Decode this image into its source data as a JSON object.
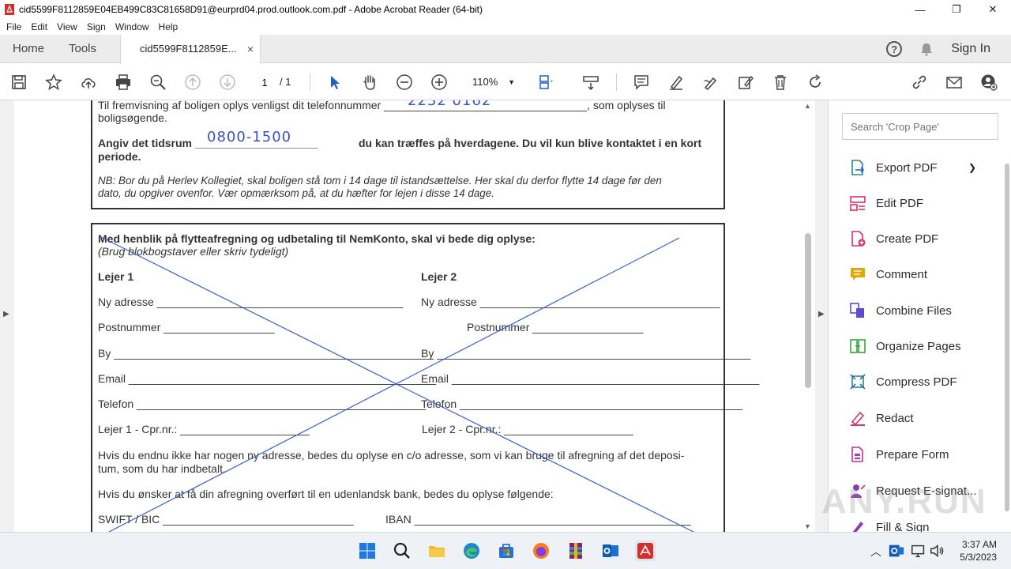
{
  "window": {
    "title": "cid5599F8112859E04EB499C83C81658D91@eurprd04.prod.outlook.com.pdf - Adobe Acrobat Reader (64-bit)",
    "minimize": "—",
    "maximize": "❐",
    "close": "✕"
  },
  "menu": [
    "File",
    "Edit",
    "View",
    "Sign",
    "Window",
    "Help"
  ],
  "tabs": {
    "home": "Home",
    "tools": "Tools",
    "doc": "cid5599F8112859E...",
    "doc_close": "×",
    "help": "?",
    "signin": "Sign In"
  },
  "toolbar": {
    "page_current": "1",
    "page_total": "/ 1",
    "zoom": "110%"
  },
  "document": {
    "line1": "Til fremvisning af boligen oplys venligst dit telefonnummer _________________________________, som oplyses til",
    "line1b": "boligsøgende.",
    "hand_phone": "2232 0162",
    "line2_a": "Angiv det tidsrum ____________________",
    "line2_b": "du kan træffes på hverdagene. Du vil kun blive kontaktet i en kort",
    "line2c": "periode.",
    "hand_time": "0800-1500",
    "nb1": "NB: Bor du på Herlev Kollegiet, skal boligen stå tom i 14 dage til istandsættelse. Her skal du derfor flytte 14 dage før den",
    "nb2": "dato, du opgiver ovenfor. Vær opmærksom på, at du hæfter for lejen i disse 14 dage.",
    "heading": "Med henblik på flytteafregning og udbetaling til NemKonto, skal vi bede dig oplyse:",
    "subheading": "(Brug blokbogstaver eller skriv tydeligt)",
    "tenant1": "Lejer 1",
    "tenant2": "Lejer 2",
    "addr1": "Ny adresse ________________________________________",
    "addr2": "Ny adresse _______________________________________",
    "zip1": "Postnummer __________________",
    "zip2": "Postnummer __________________",
    "city1": "By ____________________________________________________",
    "city2": "By ___________________________________________________",
    "email1": "Email __________________________________________________",
    "email2": "Email __________________________________________________",
    "phone1": "Telefon _______________________________________________",
    "phone2": "Telefon ______________________________________________",
    "cpr1": "Lejer 1 - Cpr.nr.:    _____________________",
    "cpr2": "Lejer 2 - Cpr.nr.:  _____________________",
    "co1": "Hvis du endnu ikke har nogen ny adresse, bedes du oplyse en c/o adresse, som vi kan bruge til afregning af det deposi-",
    "co2": "tum, som du har indbetalt.",
    "foreign": "Hvis du ønsker at få din afregning overført til en udenlandsk bank, bedes du oplyse følgende:",
    "swift": "SWIFT / BIC _______________________________",
    "iban": "IBAN _____________________________________________"
  },
  "tools_pane": {
    "search_placeholder": "Search 'Crop Page'",
    "items": [
      {
        "label": "Export PDF",
        "icon": "export-pdf-icon",
        "color": "#2b8a7a"
      },
      {
        "label": "Edit PDF",
        "icon": "edit-pdf-icon",
        "color": "#d6336c"
      },
      {
        "label": "Create PDF",
        "icon": "create-pdf-icon",
        "color": "#d6336c"
      },
      {
        "label": "Comment",
        "icon": "comment-icon",
        "color": "#e0a800"
      },
      {
        "label": "Combine Files",
        "icon": "combine-files-icon",
        "color": "#5b4bcf"
      },
      {
        "label": "Organize Pages",
        "icon": "organize-pages-icon",
        "color": "#3aa33a"
      },
      {
        "label": "Compress PDF",
        "icon": "compress-pdf-icon",
        "color": "#2b8a7a"
      },
      {
        "label": "Redact",
        "icon": "redact-icon",
        "color": "#d6336c"
      },
      {
        "label": "Prepare Form",
        "icon": "prepare-form-icon",
        "color": "#c2339c"
      },
      {
        "label": "Request E-signat...",
        "icon": "request-esign-icon",
        "color": "#8e3bb3"
      },
      {
        "label": "Fill & Sign",
        "icon": "fill-sign-icon",
        "color": "#8e3bb3"
      }
    ]
  },
  "watermark": "ANY.RUN",
  "taskbar": {
    "time": "3:37 AM",
    "date": "5/3/2023"
  }
}
